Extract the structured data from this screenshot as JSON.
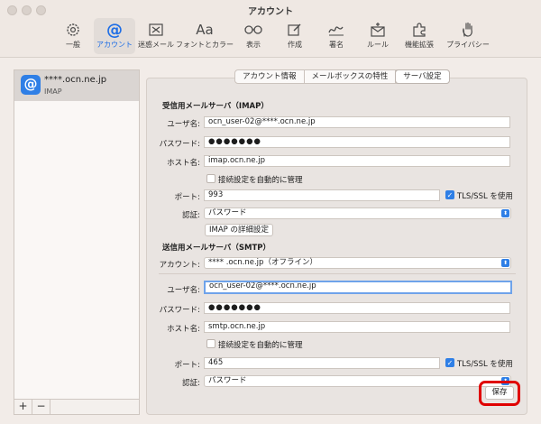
{
  "window": {
    "title": "アカウント"
  },
  "toolbar": {
    "items": [
      {
        "label": "一般",
        "icon": "gear-icon"
      },
      {
        "label": "アカウント",
        "icon": "at-icon",
        "active": true
      },
      {
        "label": "迷惑メール",
        "icon": "junk-icon"
      },
      {
        "label": "フォントとカラー",
        "icon": "font-icon",
        "glyph": "Aa"
      },
      {
        "label": "表示",
        "icon": "glasses-icon"
      },
      {
        "label": "作成",
        "icon": "compose-icon"
      },
      {
        "label": "署名",
        "icon": "signature-icon"
      },
      {
        "label": "ルール",
        "icon": "rules-icon"
      },
      {
        "label": "機能拡張",
        "icon": "puzzle-icon"
      },
      {
        "label": "プライバシー",
        "icon": "hand-icon"
      }
    ]
  },
  "sidebar": {
    "account": {
      "name": "****.ocn.ne.jp",
      "type": "IMAP",
      "icon_glyph": "@"
    },
    "add_label": "+",
    "remove_label": "−"
  },
  "tabs": [
    {
      "label": "アカウント情報"
    },
    {
      "label": "メールボックスの特性"
    },
    {
      "label": "サーバ設定",
      "active": true
    }
  ],
  "imap": {
    "section_title": "受信用メールサーバ（IMAP）",
    "username_label": "ユーザ名:",
    "username": "ocn_user-02@****.ocn.ne.jp",
    "password_label": "パスワード:",
    "password": "●●●●●●●",
    "host_label": "ホスト名:",
    "host": "imap.ocn.ne.jp",
    "auto_manage_label": "接続設定を自動的に管理",
    "port_label": "ポート:",
    "port": "993",
    "tls_label": "TLS/SSL を使用",
    "auth_label": "認証:",
    "auth": "パスワード",
    "advanced_button": "IMAP の詳細設定"
  },
  "smtp": {
    "section_title": "送信用メールサーバ（SMTP）",
    "account_label": "アカウント:",
    "account": "**** .ocn.ne.jp（オフライン）",
    "username_label": "ユーザ名:",
    "username": "ocn_user-02@****.ocn.ne.jp",
    "password_label": "パスワード:",
    "password": "●●●●●●●",
    "host_label": "ホスト名:",
    "host": "smtp.ocn.ne.jp",
    "auto_manage_label": "接続設定を自動的に管理",
    "port_label": "ポート:",
    "port": "465",
    "tls_label": "TLS/SSL を使用",
    "auth_label": "認証:",
    "auth": "パスワード"
  },
  "actions": {
    "save": "保存"
  },
  "colors": {
    "accent": "#2f7fe6",
    "highlight": "#e00000"
  }
}
